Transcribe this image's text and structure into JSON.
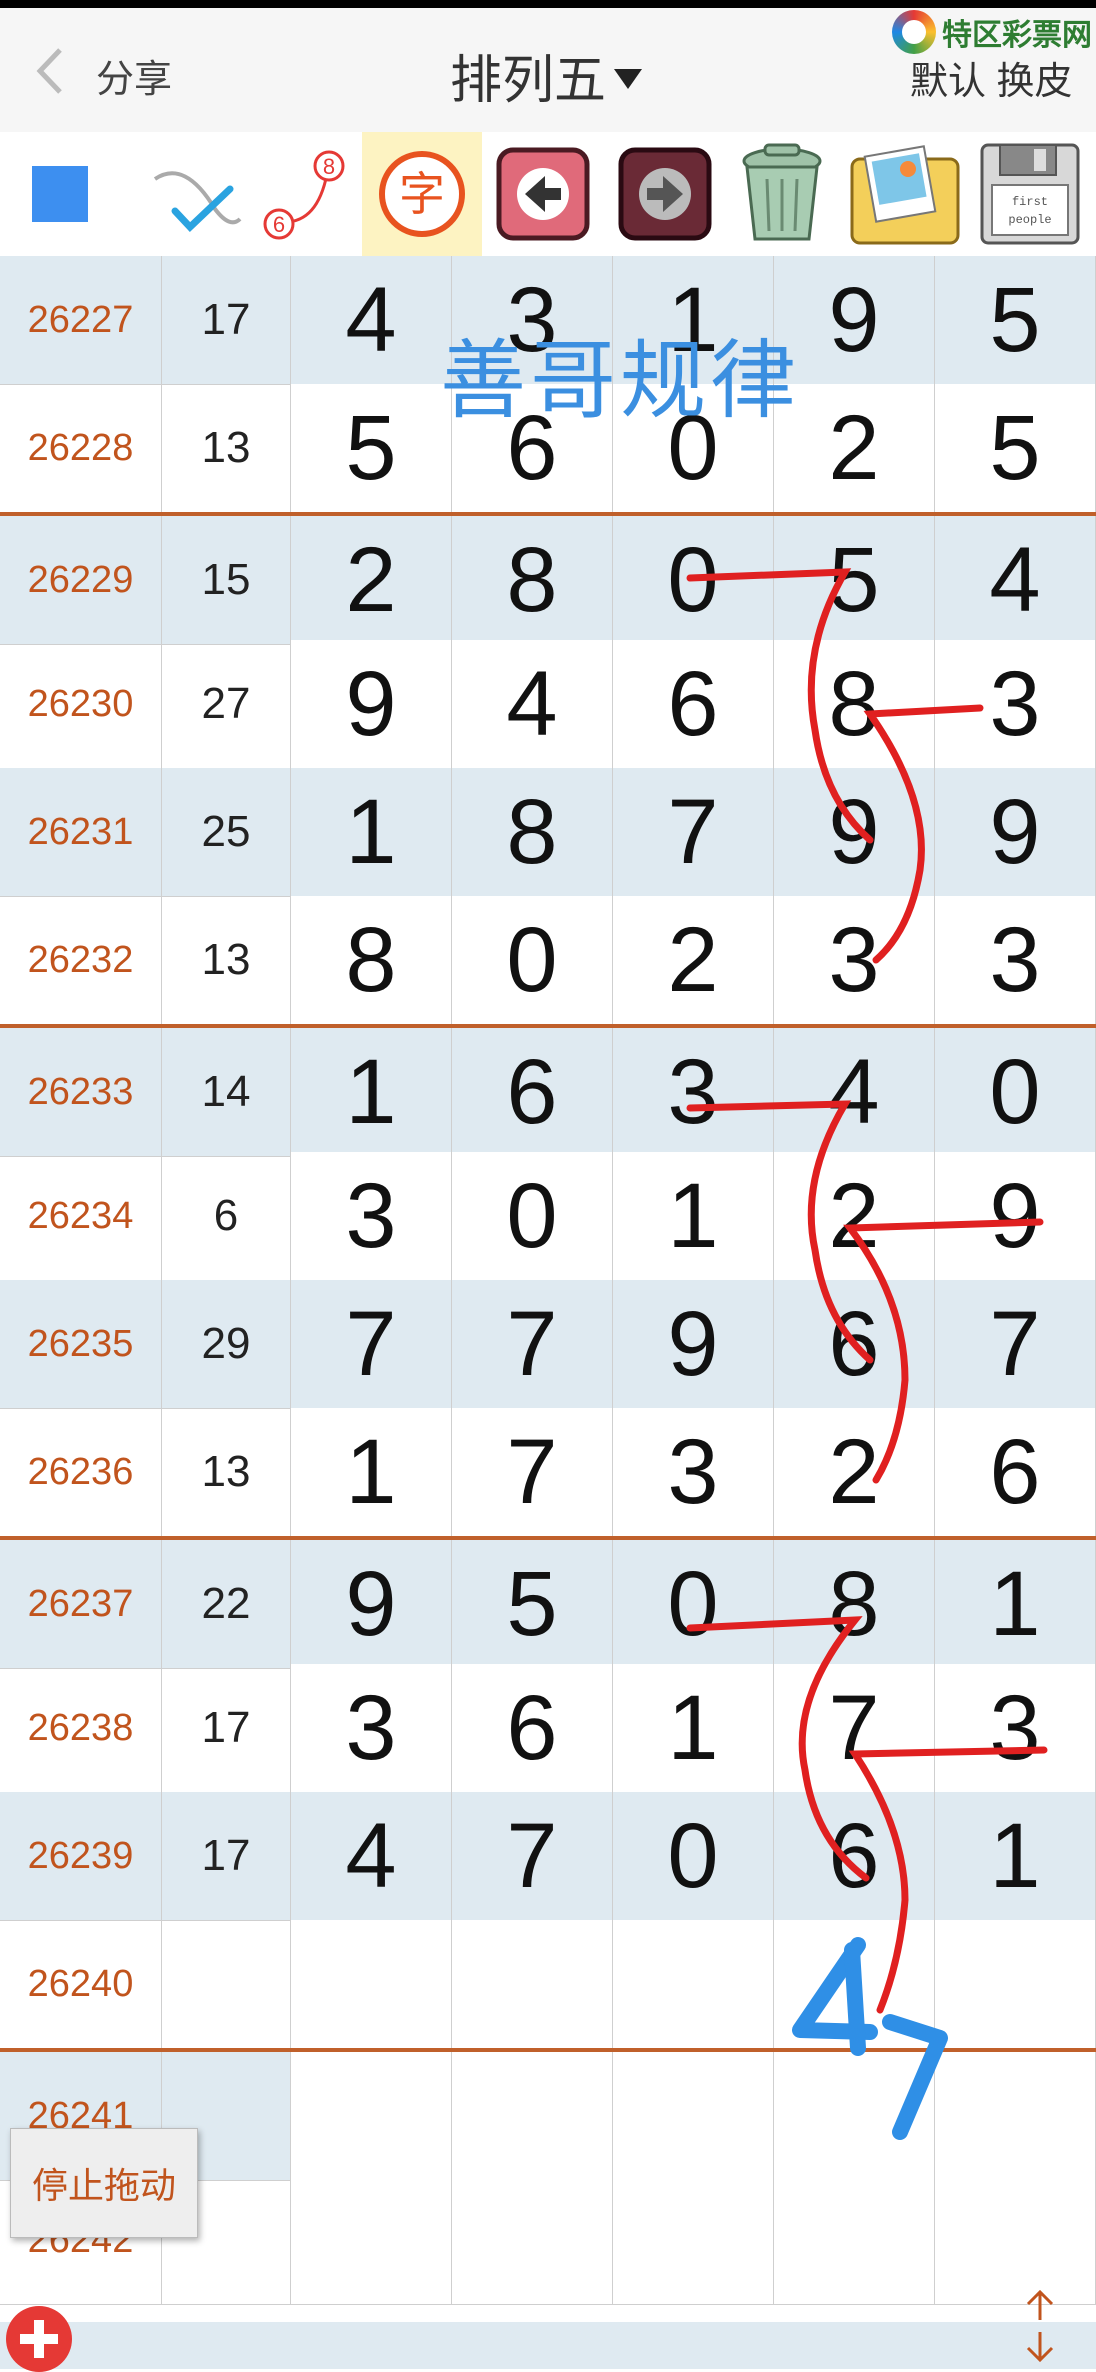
{
  "header": {
    "back_label": "",
    "share": "分享",
    "title": "排列五",
    "logo_text": "特区彩票网",
    "skin": "默认 换皮"
  },
  "toolbar": {
    "icons": [
      "blue-square-icon",
      "check-pen-icon",
      "number-link-icon",
      "char-icon",
      "back-arrow-icon",
      "forward-arrow-icon",
      "trash-icon",
      "photo-folder-icon",
      "save-disk-icon"
    ],
    "char_label": "字",
    "link_top": "8",
    "link_bottom": "6",
    "disk_label_1": "first",
    "disk_label_2": "people"
  },
  "watermark": "善哥规律",
  "rows": [
    {
      "issue": "26227",
      "sum": "17",
      "d": [
        "4",
        "3",
        "1",
        "9",
        "5"
      ]
    },
    {
      "issue": "26228",
      "sum": "13",
      "d": [
        "5",
        "6",
        "0",
        "2",
        "5"
      ]
    },
    {
      "issue": "26229",
      "sum": "15",
      "d": [
        "2",
        "8",
        "0",
        "5",
        "4"
      ]
    },
    {
      "issue": "26230",
      "sum": "27",
      "d": [
        "9",
        "4",
        "6",
        "8",
        "3"
      ]
    },
    {
      "issue": "26231",
      "sum": "25",
      "d": [
        "1",
        "8",
        "7",
        "9",
        "9"
      ]
    },
    {
      "issue": "26232",
      "sum": "13",
      "d": [
        "8",
        "0",
        "2",
        "3",
        "3"
      ]
    },
    {
      "issue": "26233",
      "sum": "14",
      "d": [
        "1",
        "6",
        "3",
        "4",
        "0"
      ]
    },
    {
      "issue": "26234",
      "sum": "6",
      "d": [
        "3",
        "0",
        "1",
        "2",
        "9"
      ]
    },
    {
      "issue": "26235",
      "sum": "29",
      "d": [
        "7",
        "7",
        "9",
        "6",
        "7"
      ]
    },
    {
      "issue": "26236",
      "sum": "13",
      "d": [
        "1",
        "7",
        "3",
        "2",
        "6"
      ]
    },
    {
      "issue": "26237",
      "sum": "22",
      "d": [
        "9",
        "5",
        "0",
        "8",
        "1"
      ]
    },
    {
      "issue": "26238",
      "sum": "17",
      "d": [
        "3",
        "6",
        "1",
        "7",
        "3"
      ]
    },
    {
      "issue": "26239",
      "sum": "17",
      "d": [
        "4",
        "7",
        "0",
        "6",
        "1"
      ]
    },
    {
      "issue": "26240",
      "sum": "",
      "d": [
        "",
        "",
        "",
        "",
        ""
      ]
    },
    {
      "issue": "26241",
      "sum": "",
      "d": [
        "",
        "",
        "",
        "",
        ""
      ]
    },
    {
      "issue": "26242",
      "sum": "",
      "d": [
        "",
        "",
        "",
        "",
        ""
      ]
    }
  ],
  "handwritten": "47",
  "stop_button": "停止拖动",
  "colors": {
    "accent": "#c1541d",
    "row_alt": "#dfeaf1",
    "ink_red": "#e02020",
    "ink_blue": "#2f8fe6"
  }
}
